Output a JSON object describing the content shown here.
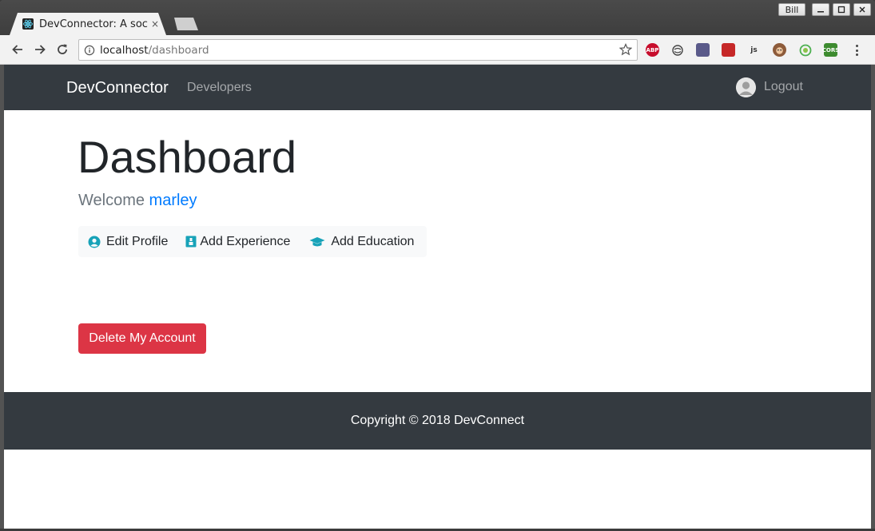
{
  "browser": {
    "tab_title": "DevConnector: A social network for developers",
    "tab_close": "×",
    "user_chip": "Bill",
    "url_host": "localhost",
    "url_path": "/dashboard",
    "extensions": [
      {
        "name": "adblock-plus-icon",
        "label": "ABP",
        "color": "#c70d2c"
      },
      {
        "name": "sync-icon",
        "label": "",
        "color": "#f2f2f2"
      },
      {
        "name": "ext-puzzle-icon",
        "label": "",
        "color": "#5a5a8a"
      },
      {
        "name": "ext-red-icon",
        "label": "",
        "color": "#c62828"
      },
      {
        "name": "ext-js-icon",
        "label": "js",
        "color": "#f2f2f2"
      },
      {
        "name": "ext-monkey-icon",
        "label": "",
        "color": "#8d5b3a"
      },
      {
        "name": "ext-target-icon",
        "label": "",
        "color": "#4caf50"
      },
      {
        "name": "cors-icon",
        "label": "CORS",
        "color": "#3d8b2f"
      }
    ]
  },
  "navbar": {
    "brand": "DevConnector",
    "developers": "Developers",
    "logout": "Logout"
  },
  "main": {
    "title": "Dashboard",
    "welcome_prefix": "Welcome ",
    "user_name": "marley",
    "actions": {
      "edit_profile": "Edit Profile",
      "add_experience": "Add Experience",
      "add_education": "Add Education"
    },
    "delete_account": "Delete My Account"
  },
  "footer": {
    "copyright": "Copyright © 2018 DevConnect"
  },
  "colors": {
    "navbar_bg": "#343a40",
    "link": "#007bff",
    "icon_accent": "#17a2b8",
    "danger": "#dc3545"
  }
}
